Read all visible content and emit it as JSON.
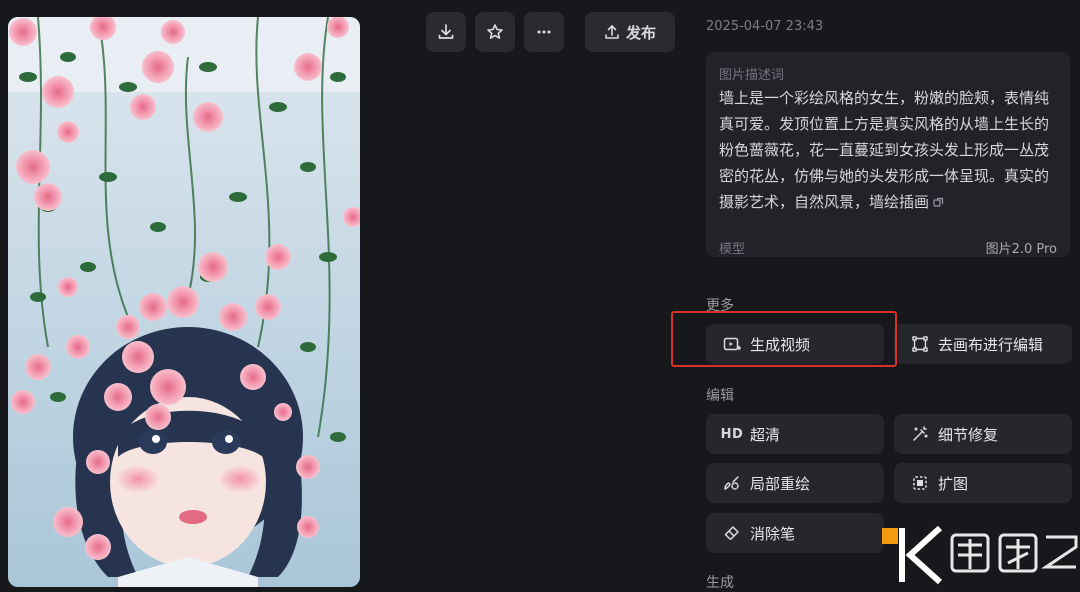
{
  "toolbar": {
    "download_icon": "download-icon",
    "star_icon": "star-icon",
    "more_icon": "more-icon",
    "publish_label": "发布"
  },
  "meta": {
    "timestamp": "2025-04-07 23:43"
  },
  "description": {
    "label": "图片描述词",
    "text": "墙上是一个彩绘风格的女生，粉嫩的脸颊，表情纯真可爱。发顶位置上方是真实风格的从墙上生长的粉色蔷薇花，花一直蔓延到女孩头发上形成一丛茂密的花丛，仿佛与她的头发形成一体呈现。真实的摄影艺术，自然风景，墙绘插画",
    "model_label": "模型",
    "model_value": "图片2.0 Pro"
  },
  "sections": {
    "more": {
      "title": "更多",
      "items": [
        "生成视频",
        "去画布进行编辑"
      ]
    },
    "edit": {
      "title": "编辑",
      "items": [
        {
          "prefix": "HD",
          "label": "超清"
        },
        {
          "label": "细节修复"
        },
        {
          "label": "局部重绘"
        },
        {
          "label": "扩图"
        },
        {
          "label": "消除笔"
        }
      ]
    },
    "generate": {
      "title": "生成"
    }
  },
  "colors": {
    "background": "#17181c",
    "card": "#222328",
    "button": "#26272c",
    "highlight": "#d9302a",
    "watermark_accent": "#f39c12"
  }
}
